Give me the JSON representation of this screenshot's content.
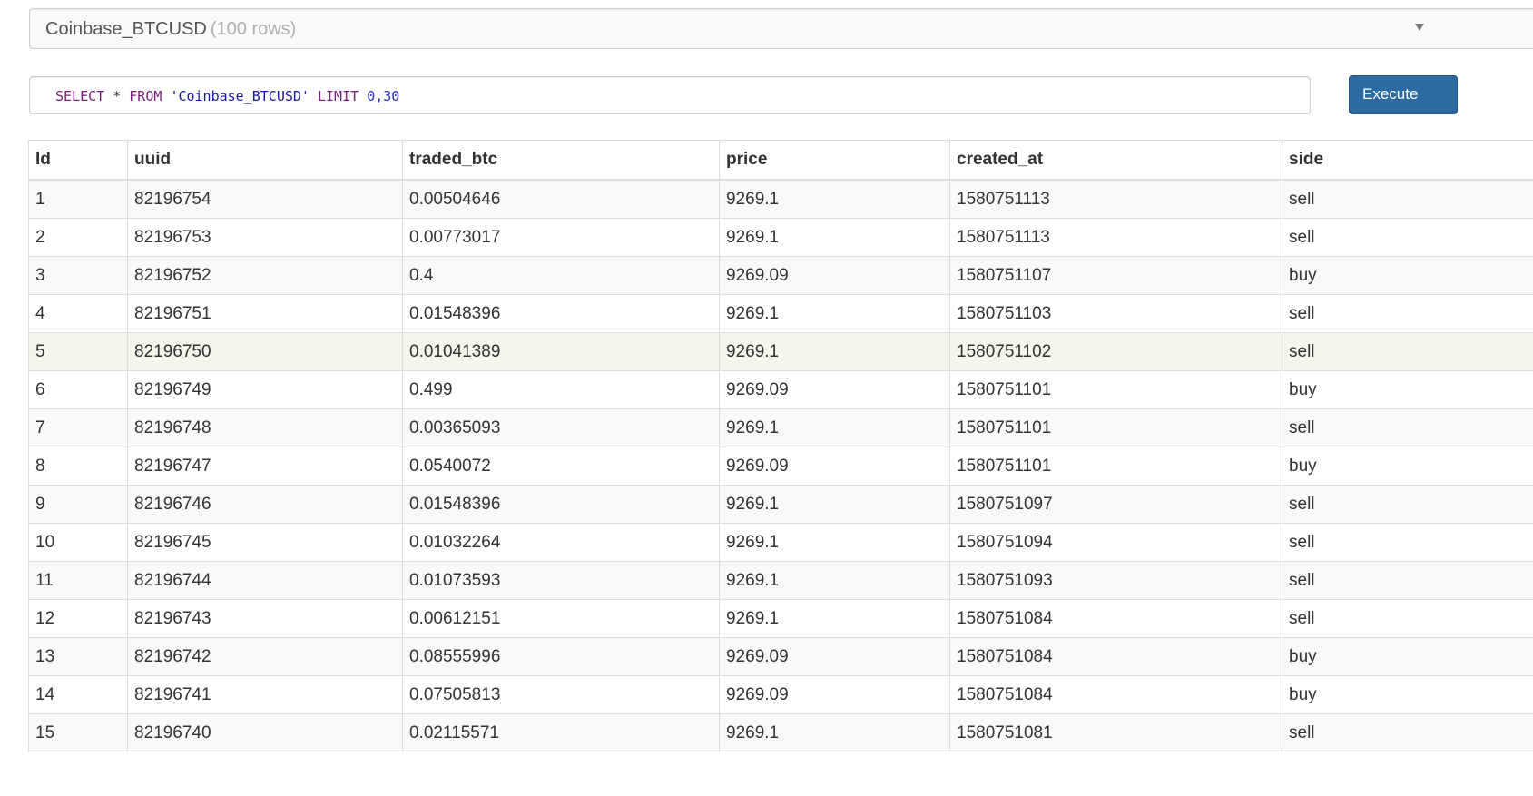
{
  "table_selector": {
    "name": "Coinbase_BTCUSD",
    "row_count": "(100 rows)"
  },
  "query": {
    "tokens": [
      {
        "text": "SELECT",
        "kind": "kw"
      },
      {
        "text": " * ",
        "kind": "op"
      },
      {
        "text": "FROM",
        "kind": "kw"
      },
      {
        "text": " ",
        "kind": "op"
      },
      {
        "text": "'Coinbase_BTCUSD'",
        "kind": "str"
      },
      {
        "text": " ",
        "kind": "op"
      },
      {
        "text": "LIMIT",
        "kind": "kw"
      },
      {
        "text": " ",
        "kind": "op"
      },
      {
        "text": "0,30",
        "kind": "num"
      }
    ]
  },
  "execute_label": "Execute",
  "results": {
    "columns": [
      "Id",
      "uuid",
      "traded_btc",
      "price",
      "created_at",
      "side"
    ],
    "highlighted_row": 5,
    "rows": [
      [
        "1",
        "82196754",
        "0.00504646",
        "9269.1",
        "1580751113",
        "sell"
      ],
      [
        "2",
        "82196753",
        "0.00773017",
        "9269.1",
        "1580751113",
        "sell"
      ],
      [
        "3",
        "82196752",
        "0.4",
        "9269.09",
        "1580751107",
        "buy"
      ],
      [
        "4",
        "82196751",
        "0.01548396",
        "9269.1",
        "1580751103",
        "sell"
      ],
      [
        "5",
        "82196750",
        "0.01041389",
        "9269.1",
        "1580751102",
        "sell"
      ],
      [
        "6",
        "82196749",
        "0.499",
        "9269.09",
        "1580751101",
        "buy"
      ],
      [
        "7",
        "82196748",
        "0.00365093",
        "9269.1",
        "1580751101",
        "sell"
      ],
      [
        "8",
        "82196747",
        "0.0540072",
        "9269.09",
        "1580751101",
        "buy"
      ],
      [
        "9",
        "82196746",
        "0.01548396",
        "9269.1",
        "1580751097",
        "sell"
      ],
      [
        "10",
        "82196745",
        "0.01032264",
        "9269.1",
        "1580751094",
        "sell"
      ],
      [
        "11",
        "82196744",
        "0.01073593",
        "9269.1",
        "1580751093",
        "sell"
      ],
      [
        "12",
        "82196743",
        "0.00612151",
        "9269.1",
        "1580751084",
        "sell"
      ],
      [
        "13",
        "82196742",
        "0.08555996",
        "9269.09",
        "1580751084",
        "buy"
      ],
      [
        "14",
        "82196741",
        "0.07505813",
        "9269.09",
        "1580751084",
        "buy"
      ],
      [
        "15",
        "82196740",
        "0.02115571",
        "9269.1",
        "1580751081",
        "sell"
      ]
    ]
  }
}
